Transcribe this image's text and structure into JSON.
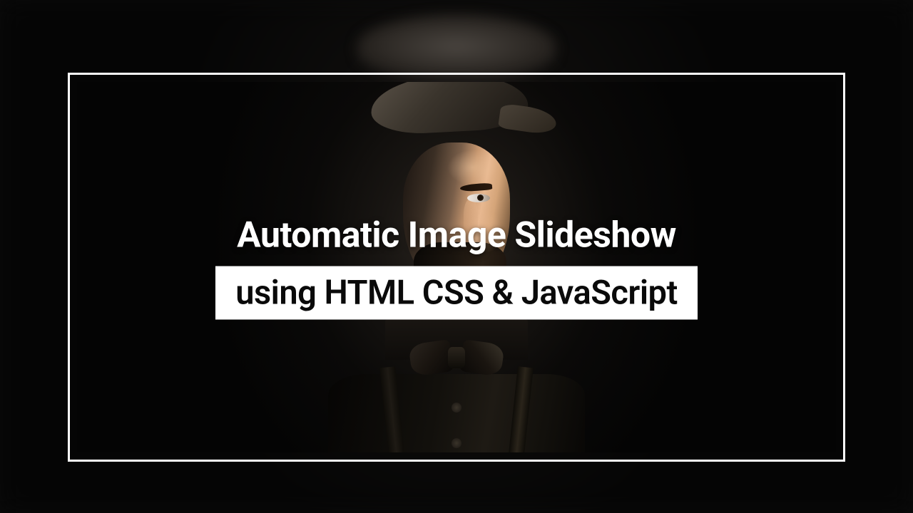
{
  "title": {
    "line1": "Automatic Image Slideshow",
    "line2": "using HTML CSS & JavaScript"
  }
}
